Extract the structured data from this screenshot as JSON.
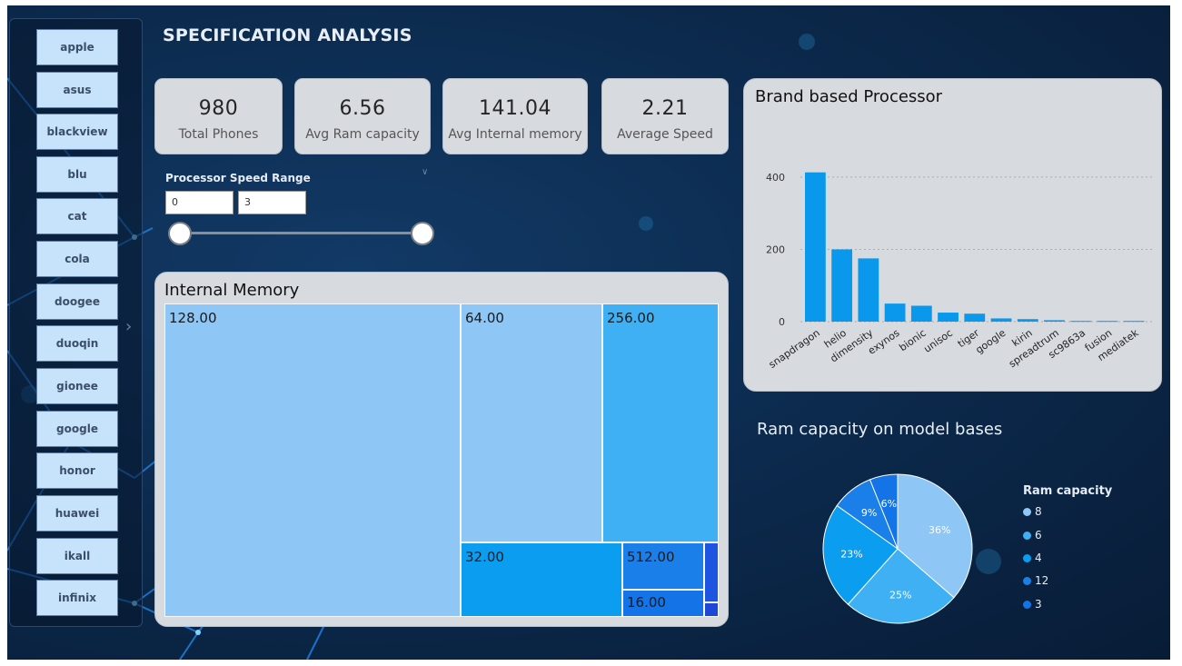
{
  "page_title": "SPECIFICATION ANALYSIS",
  "brands": [
    "apple",
    "asus",
    "blackview",
    "blu",
    "cat",
    "cola",
    "doogee",
    "duoqin",
    "gionee",
    "google",
    "honor",
    "huawei",
    "ikall",
    "infinix"
  ],
  "kpis": [
    {
      "value": "980",
      "label": "Total Phones"
    },
    {
      "value": "6.56",
      "label": "Avg Ram capacity"
    },
    {
      "value": "141.04",
      "label": "Avg Internal memory"
    },
    {
      "value": "2.21",
      "label": "Average Speed"
    }
  ],
  "speed_range": {
    "title": "Processor Speed Range",
    "min": "0",
    "max": "3"
  },
  "internal_memory": {
    "title": "Internal Memory",
    "labels": [
      "128.00",
      "64.00",
      "256.00",
      "32.00",
      "512.00",
      "16.00"
    ]
  },
  "colors": {
    "light": "#8ec6f5",
    "mid": "#0b9ef0",
    "sky": "#3fb0f3",
    "deep": "#1a7fe8",
    "blue": "#1473e6",
    "royal": "#1e55e0"
  },
  "chart_data": [
    {
      "type": "bar",
      "title": "Brand based Processor",
      "categories": [
        "snapdragon",
        "helio",
        "dimensity",
        "exynos",
        "bionic",
        "unisoc",
        "tiger",
        "google",
        "kirin",
        "spreadtrum",
        "sc9863a",
        "fusion",
        "mediatek"
      ],
      "values": [
        413,
        200,
        175,
        50,
        44,
        25,
        22,
        9,
        7,
        4,
        2,
        2,
        2
      ],
      "yticks": [
        "0",
        "200",
        "400"
      ],
      "ylim": [
        0,
        450
      ],
      "grid": true,
      "color": "#0a98ec"
    },
    {
      "type": "pie",
      "title": "Ram capacity on model bases",
      "legend_title": "Ram capacity",
      "legend": [
        "8",
        "6",
        "4",
        "12",
        "3"
      ],
      "slice_labels": [
        "36%",
        "25%",
        "23%",
        "9%",
        "6%"
      ],
      "values": [
        36,
        25,
        23,
        9,
        6
      ],
      "colors": [
        "#8ec6f5",
        "#3fb0f3",
        "#0b9ef0",
        "#1a7fe8",
        "#1473e6"
      ]
    }
  ]
}
